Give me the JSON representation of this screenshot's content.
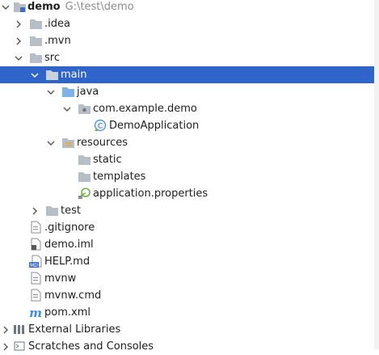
{
  "tree": {
    "root": {
      "label": "demo",
      "path": "G:\\test\\demo"
    },
    "idea": ".idea",
    "mvn": ".mvn",
    "src": "src",
    "main": "main",
    "java": "java",
    "package": "com.example.demo",
    "app_class": "DemoApplication",
    "resources": "resources",
    "static": "static",
    "templates": "templates",
    "app_props": "application.properties",
    "test": "test",
    "gitignore": ".gitignore",
    "demo_iml": "demo.iml",
    "help_md": "HELP.md",
    "mvnw": "mvnw",
    "mvnw_cmd": "mvnw.cmd",
    "pom": "pom.xml",
    "external_libraries": "External Libraries",
    "scratches": "Scratches and Consoles"
  },
  "icons": {
    "md_badge": "MD",
    "maven_badge": "m"
  },
  "colors": {
    "selection": "#2f65ca",
    "folder": "#b8bec6",
    "source_folder": "#7fb2e5",
    "resource_folder": "#b8bec6",
    "spring_green": "#6db33f",
    "muted_text": "#8c8c8c"
  }
}
